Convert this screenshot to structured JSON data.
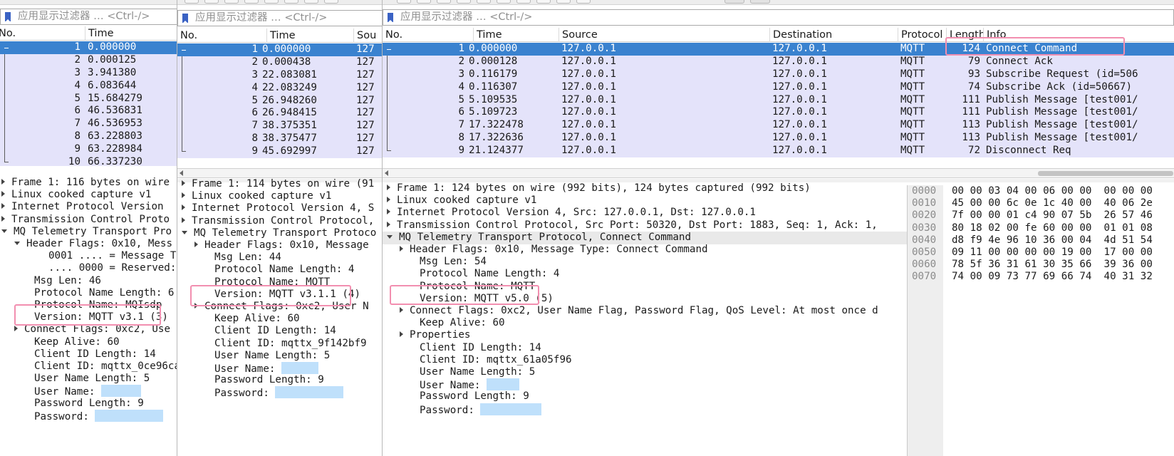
{
  "filter_placeholder": "应用显示过滤器 … <Ctrl-/>",
  "panes": [
    {
      "columns": [
        "No.",
        "Time"
      ],
      "packets": [
        {
          "no": "1",
          "time": "0.000000"
        },
        {
          "no": "2",
          "time": "0.000125"
        },
        {
          "no": "3",
          "time": "3.941380"
        },
        {
          "no": "4",
          "time": "6.083644"
        },
        {
          "no": "5",
          "time": "15.684279"
        },
        {
          "no": "6",
          "time": "46.536831"
        },
        {
          "no": "7",
          "time": "46.536953"
        },
        {
          "no": "8",
          "time": "63.228803"
        },
        {
          "no": "9",
          "time": "63.228984"
        },
        {
          "no": "10",
          "time": "66.337230"
        }
      ],
      "details": [
        {
          "text": "Frame 1: 116 bytes on wire"
        },
        {
          "text": "Linux cooked capture v1"
        },
        {
          "text": "Internet Protocol Version"
        },
        {
          "text": "Transmission Control Proto"
        },
        {
          "text": "MQ Telemetry Transport Pro"
        },
        {
          "text": "Header Flags: 0x10, Mess"
        },
        {
          "text": "0001 .... = Message Ty"
        },
        {
          "text": ".... 0000 = Reserved:"
        },
        {
          "text": "Msg Len: 46"
        },
        {
          "text": "Protocol Name Length: 6"
        },
        {
          "text": "Protocol Name: MQIsdp"
        },
        {
          "text": "Version: MQTT v3.1 (3)"
        },
        {
          "text": "Connect Flags: 0xc2, Use"
        },
        {
          "text": "Keep Alive: 60"
        },
        {
          "text": "Client ID Length: 14"
        },
        {
          "text": "Client ID: mqttx_0ce96ca"
        },
        {
          "text": "User Name Length: 5"
        },
        {
          "text": "User Name:"
        },
        {
          "text": "Password Length: 9"
        },
        {
          "text": "Password:"
        }
      ]
    },
    {
      "columns": [
        "No.",
        "Time",
        "Sou"
      ],
      "packets": [
        {
          "no": "1",
          "time": "0.000000",
          "src": "127"
        },
        {
          "no": "2",
          "time": "0.000438",
          "src": "127"
        },
        {
          "no": "3",
          "time": "22.083081",
          "src": "127"
        },
        {
          "no": "4",
          "time": "22.083249",
          "src": "127"
        },
        {
          "no": "5",
          "time": "26.948260",
          "src": "127"
        },
        {
          "no": "6",
          "time": "26.948415",
          "src": "127"
        },
        {
          "no": "7",
          "time": "38.375351",
          "src": "127"
        },
        {
          "no": "8",
          "time": "38.375477",
          "src": "127"
        },
        {
          "no": "9",
          "time": "45.692997",
          "src": "127"
        }
      ],
      "details": [
        {
          "text": "Frame 1: 114 bytes on wire (91"
        },
        {
          "text": "Linux cooked capture v1"
        },
        {
          "text": "Internet Protocol Version 4, S"
        },
        {
          "text": "Transmission Control Protocol,"
        },
        {
          "text": "MQ Telemetry Transport Protoco"
        },
        {
          "text": "Header Flags: 0x10, Message"
        },
        {
          "text": "Msg Len: 44"
        },
        {
          "text": "Protocol Name Length: 4"
        },
        {
          "text": "Protocol Name: MQTT"
        },
        {
          "text": "Version: MQTT v3.1.1 (4)"
        },
        {
          "text": "Connect Flags: 0xc2, User N"
        },
        {
          "text": "Keep Alive: 60"
        },
        {
          "text": "Client ID Length: 14"
        },
        {
          "text": "Client ID: mqttx_9f142bf9"
        },
        {
          "text": "User Name Length: 5"
        },
        {
          "text": "User Name:"
        },
        {
          "text": "Password Length: 9"
        },
        {
          "text": "Password:"
        }
      ]
    },
    {
      "columns": [
        "No.",
        "Time",
        "Source",
        "Destination",
        "Protocol",
        "Length",
        "Info"
      ],
      "packets": [
        {
          "no": "1",
          "time": "0.000000",
          "src": "127.0.0.1",
          "dst": "127.0.0.1",
          "proto": "MQTT",
          "len": "124",
          "info": "Connect Command"
        },
        {
          "no": "2",
          "time": "0.000128",
          "src": "127.0.0.1",
          "dst": "127.0.0.1",
          "proto": "MQTT",
          "len": "79",
          "info": "Connect Ack"
        },
        {
          "no": "3",
          "time": "0.116179",
          "src": "127.0.0.1",
          "dst": "127.0.0.1",
          "proto": "MQTT",
          "len": "93",
          "info": "Subscribe Request (id=506"
        },
        {
          "no": "4",
          "time": "0.116307",
          "src": "127.0.0.1",
          "dst": "127.0.0.1",
          "proto": "MQTT",
          "len": "74",
          "info": "Subscribe Ack (id=50667)"
        },
        {
          "no": "5",
          "time": "5.109535",
          "src": "127.0.0.1",
          "dst": "127.0.0.1",
          "proto": "MQTT",
          "len": "111",
          "info": "Publish Message [test001/"
        },
        {
          "no": "6",
          "time": "5.109723",
          "src": "127.0.0.1",
          "dst": "127.0.0.1",
          "proto": "MQTT",
          "len": "111",
          "info": "Publish Message [test001/"
        },
        {
          "no": "7",
          "time": "17.322478",
          "src": "127.0.0.1",
          "dst": "127.0.0.1",
          "proto": "MQTT",
          "len": "113",
          "info": "Publish Message [test001/"
        },
        {
          "no": "8",
          "time": "17.322636",
          "src": "127.0.0.1",
          "dst": "127.0.0.1",
          "proto": "MQTT",
          "len": "113",
          "info": "Publish Message [test001/"
        },
        {
          "no": "9",
          "time": "21.124377",
          "src": "127.0.0.1",
          "dst": "127.0.0.1",
          "proto": "MQTT",
          "len": "72",
          "info": "Disconnect Req"
        }
      ],
      "details": [
        {
          "text": "Frame 1: 124 bytes on wire (992 bits), 124 bytes captured (992 bits)"
        },
        {
          "text": "Linux cooked capture v1"
        },
        {
          "text": "Internet Protocol Version 4, Src: 127.0.0.1, Dst: 127.0.0.1"
        },
        {
          "text": "Transmission Control Protocol, Src Port: 50320, Dst Port: 1883, Seq: 1, Ack: 1,"
        },
        {
          "text": "MQ Telemetry Transport Protocol, Connect Command"
        },
        {
          "text": "Header Flags: 0x10, Message Type: Connect Command"
        },
        {
          "text": "Msg Len: 54"
        },
        {
          "text": "Protocol Name Length: 4"
        },
        {
          "text": "Protocol Name: MQTT"
        },
        {
          "text": "Version: MQTT v5.0 (5)"
        },
        {
          "text": "Connect Flags: 0xc2, User Name Flag, Password Flag, QoS Level: At most once d"
        },
        {
          "text": "Keep Alive: 60"
        },
        {
          "text": "Properties"
        },
        {
          "text": "Client ID Length: 14"
        },
        {
          "text": "Client ID: mqttx_61a05f96"
        },
        {
          "text": "User Name Length: 5"
        },
        {
          "text": "User Name:"
        },
        {
          "text": "Password Length: 9"
        },
        {
          "text": "Password:"
        }
      ],
      "hex": [
        {
          "offset": "0000",
          "bytes": "00 00 03 04 00 06 00 00  00 00 00"
        },
        {
          "offset": "0010",
          "bytes": "45 00 00 6c 0e 1c 40 00  40 06 2e"
        },
        {
          "offset": "0020",
          "bytes": "7f 00 00 01 c4 90 07 5b  26 57 46"
        },
        {
          "offset": "0030",
          "bytes": "80 18 02 00 fe 60 00 00  01 01 08"
        },
        {
          "offset": "0040",
          "bytes": "d8 f9 4e 96 10 36 00 04  4d 51 54"
        },
        {
          "offset": "0050",
          "bytes": "09 11 00 00 00 00 19 00  17 00 00"
        },
        {
          "offset": "0060",
          "bytes": "78 5f 36 31 61 30 35 66  39 36 00"
        },
        {
          "offset": "0070",
          "bytes": "74 00 09 73 77 69 66 74  40 31 32"
        }
      ]
    }
  ],
  "colors": {
    "selected_row": "#3a82cf",
    "mqtt_row": "#e4e3fa",
    "annotation": "#f28fb0",
    "redaction": "#bfe0fb"
  }
}
